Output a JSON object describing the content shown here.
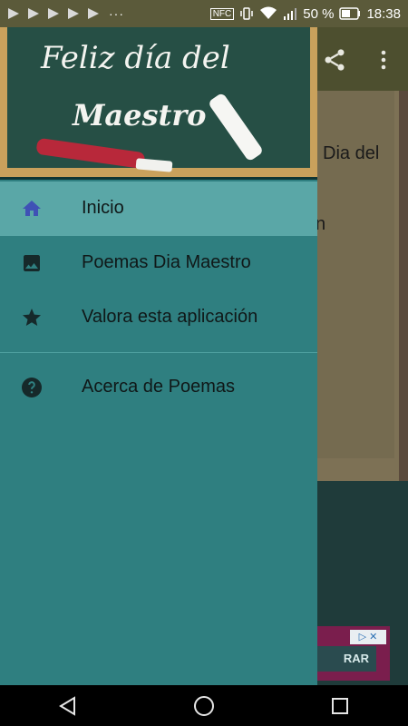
{
  "status_bar": {
    "notification_icons": [
      "media-play-icon",
      "media-play-icon",
      "media-play-icon",
      "media-play-icon",
      "media-play-icon"
    ],
    "overflow": "···",
    "nfc": "NFC",
    "battery": "50 %",
    "time": "18:38"
  },
  "header_image": {
    "line1": "Feliz día del",
    "line2": "Maestro"
  },
  "drawer": {
    "items": [
      {
        "label": "Inicio",
        "icon": "home-icon"
      },
      {
        "label": "Poemas Dia Maestro",
        "icon": "image-icon"
      },
      {
        "label": "Valora esta aplicación",
        "icon": "star-icon"
      },
      {
        "label": "Acerca de Poemas",
        "icon": "help-icon"
      }
    ]
  },
  "background": {
    "text1": "Dia del",
    "text2": "n",
    "ad_button": "RAR",
    "ad_badge": "▷ ✕"
  },
  "colors": {
    "drawer": "#2f7f80",
    "active_item": "#5aa7a7",
    "home_icon": "#3f51b5"
  }
}
